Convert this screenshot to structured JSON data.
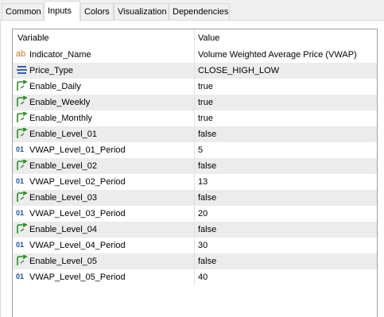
{
  "tabs": [
    {
      "label": "Common",
      "active": false
    },
    {
      "label": "Inputs",
      "active": true
    },
    {
      "label": "Colors",
      "active": false
    },
    {
      "label": "Visualization",
      "active": false
    },
    {
      "label": "Dependencies",
      "active": false
    }
  ],
  "grid": {
    "header": {
      "variable": "Variable",
      "value": "Value"
    },
    "rows": [
      {
        "icon": "string-icon",
        "icon_text": "ab",
        "variable": "Indicator_Name",
        "value": "Volume Weighted Average Price (VWAP)"
      },
      {
        "icon": "enum-icon",
        "icon_text": "",
        "variable": "Price_Type",
        "value": "CLOSE_HIGH_LOW"
      },
      {
        "icon": "bool-icon",
        "icon_text": "",
        "variable": "Enable_Daily",
        "value": "true"
      },
      {
        "icon": "bool-icon",
        "icon_text": "",
        "variable": "Enable_Weekly",
        "value": "true"
      },
      {
        "icon": "bool-icon",
        "icon_text": "",
        "variable": "Enable_Monthly",
        "value": "true"
      },
      {
        "icon": "bool-icon",
        "icon_text": "",
        "variable": "Enable_Level_01",
        "value": "false"
      },
      {
        "icon": "int-icon",
        "icon_text": "01",
        "variable": "VWAP_Level_01_Period",
        "value": "5"
      },
      {
        "icon": "bool-icon",
        "icon_text": "",
        "variable": "Enable_Level_02",
        "value": "false"
      },
      {
        "icon": "int-icon",
        "icon_text": "01",
        "variable": "VWAP_Level_02_Period",
        "value": "13"
      },
      {
        "icon": "bool-icon",
        "icon_text": "",
        "variable": "Enable_Level_03",
        "value": "false"
      },
      {
        "icon": "int-icon",
        "icon_text": "01",
        "variable": "VWAP_Level_03_Period",
        "value": "20"
      },
      {
        "icon": "bool-icon",
        "icon_text": "",
        "variable": "Enable_Level_04",
        "value": "false"
      },
      {
        "icon": "int-icon",
        "icon_text": "01",
        "variable": "VWAP_Level_04_Period",
        "value": "30"
      },
      {
        "icon": "bool-icon",
        "icon_text": "",
        "variable": "Enable_Level_05",
        "value": "false"
      },
      {
        "icon": "int-icon",
        "icon_text": "01",
        "variable": "VWAP_Level_05_Period",
        "value": "40"
      }
    ]
  },
  "colors": {
    "bool_icon": "#2a8a2a",
    "int_icon": "#1f4fa0",
    "string_icon": "#c07a20",
    "enum_icon": "#3a5fa8",
    "alt_row": "#ececec"
  }
}
